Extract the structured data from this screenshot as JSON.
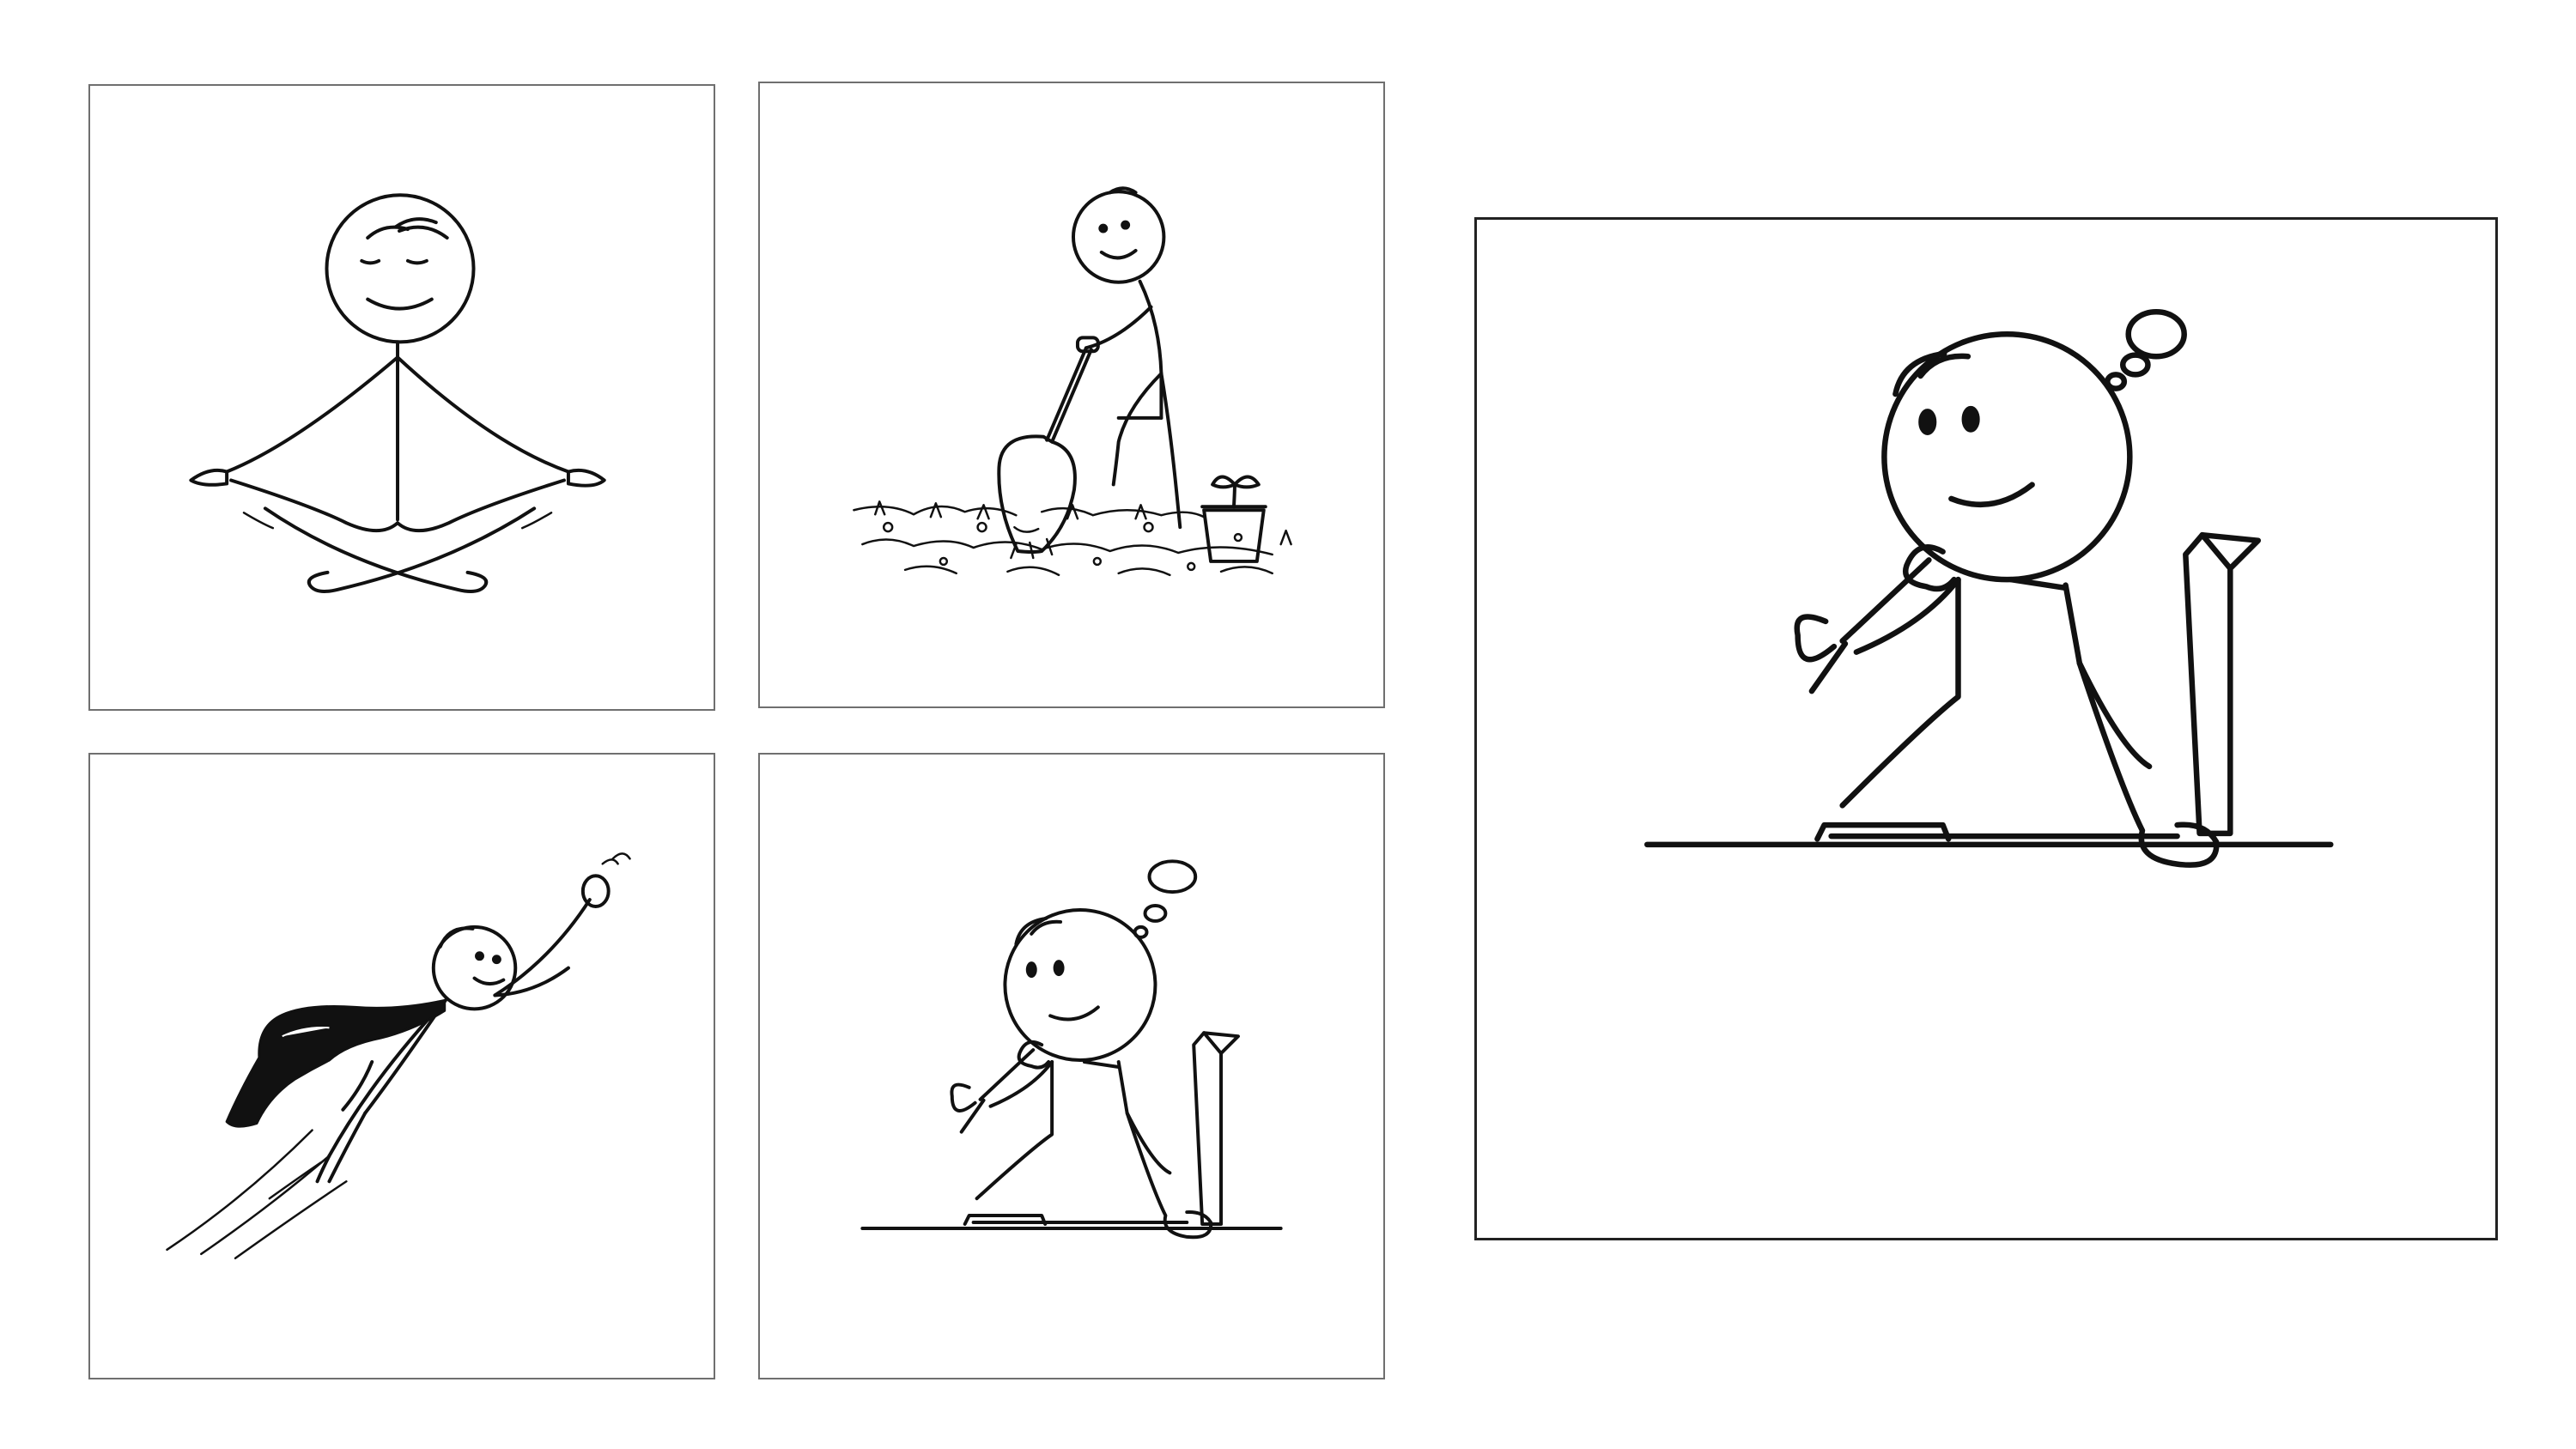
{
  "panels": [
    {
      "icon": "meditating-figure-icon"
    },
    {
      "icon": "digging-figure-icon"
    },
    {
      "icon": "flying-superhero-icon"
    },
    {
      "icon": "thinking-figure-icon"
    },
    {
      "icon": "thinking-figure-large-icon"
    }
  ],
  "colors": {
    "ink": "#111111",
    "frame": "#6f6f6f",
    "frame_featured": "#222222",
    "background": "#ffffff"
  }
}
